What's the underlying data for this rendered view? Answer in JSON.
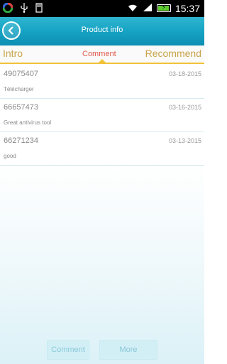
{
  "status_bar": {
    "time": "15:37",
    "battery_icon": "battery-charging-icon",
    "wifi_icon": "wifi-icon"
  },
  "header": {
    "title": "Product info"
  },
  "tabs": [
    {
      "label": "Intro"
    },
    {
      "label": "Comment",
      "active": true
    },
    {
      "label": "Recommend"
    }
  ],
  "comments": [
    {
      "user": "49075407",
      "date": "03-18-2015",
      "text": "Télécharger"
    },
    {
      "user": "66657473",
      "date": "03-16-2015",
      "text": "Great antivirus tool"
    },
    {
      "user": "66271234",
      "date": "03-13-2015",
      "text": "good"
    }
  ],
  "bottom": {
    "comment_label": "Comment",
    "more_label": "More"
  },
  "colors": {
    "header": "#16a3c4",
    "tab_text": "#c9a44a",
    "tab_active": "#e0584b",
    "tab_line": "#f2c23a"
  }
}
